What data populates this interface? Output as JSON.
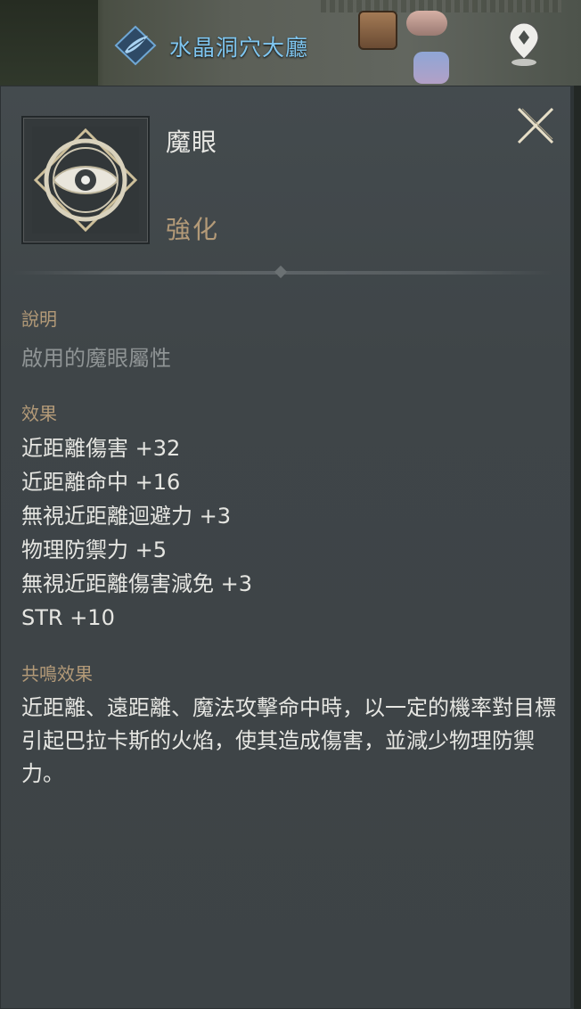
{
  "location": {
    "name": "水晶洞穴大廳",
    "icon": "crystal-feather-icon",
    "waypoint_icon": "map-pin-icon"
  },
  "tooltip": {
    "close_icon": "close-x-icon",
    "skill_icon": "eye-emblem-icon",
    "name": "魔眼",
    "type": "強化",
    "description_label": "說明",
    "description": "啟用的魔眼屬性",
    "effects_label": "效果",
    "effects": [
      "近距離傷害 +32",
      "近距離命中 +16",
      "無視近距離迴避力 +3",
      "物理防禦力 +5",
      "無視近距離傷害減免 +3",
      "STR +10"
    ],
    "resonance_label": "共鳴效果",
    "resonance_text": "近距離、遠距離、魔法攻擊命中時，以一定的機率對目標引起巴拉卡斯的火焰，使其造成傷害，並減少物理防禦力。"
  },
  "colors": {
    "location_text": "#7fc6f0",
    "label_accent": "#b39a78",
    "body_text": "#e6e6e2",
    "muted_text": "#8f9495",
    "panel_bg": "#41474a"
  }
}
